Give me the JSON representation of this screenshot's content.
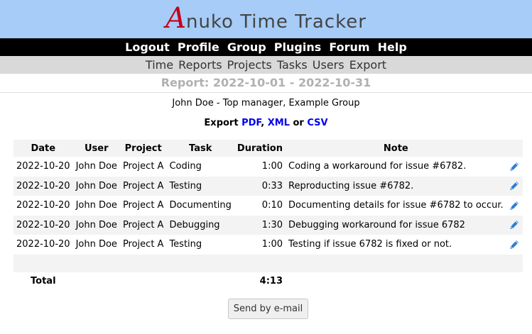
{
  "logo": {
    "first_letter": "A",
    "rest": "nuko Time Tracker"
  },
  "top_menu": [
    "Logout",
    "Profile",
    "Group",
    "Plugins",
    "Forum",
    "Help"
  ],
  "sub_menu": [
    "Time",
    "Reports",
    "Projects",
    "Tasks",
    "Users",
    "Export"
  ],
  "report": {
    "title": "Report: 2022-10-01 - 2022-10-31",
    "user_line": "John Doe - Top manager, Example Group",
    "export": {
      "prefix": "Export",
      "pdf": "PDF",
      "sep1": ",",
      "xml": "XML",
      "or": "or",
      "csv": "CSV"
    },
    "columns": [
      "Date",
      "User",
      "Project",
      "Task",
      "Duration",
      "Note"
    ],
    "rows": [
      {
        "date": "2022-10-20",
        "user": "John Doe",
        "project": "Project A",
        "task": "Coding",
        "duration": "1:00",
        "note": "Coding a workaround for issue #6782."
      },
      {
        "date": "2022-10-20",
        "user": "John Doe",
        "project": "Project A",
        "task": "Testing",
        "duration": "0:33",
        "note": "Reproducting issue #6782."
      },
      {
        "date": "2022-10-20",
        "user": "John Doe",
        "project": "Project A",
        "task": "Documenting",
        "duration": "0:10",
        "note": "Documenting details for issue #6782 to occur."
      },
      {
        "date": "2022-10-20",
        "user": "John Doe",
        "project": "Project A",
        "task": "Debugging",
        "duration": "1:30",
        "note": "Debugging workaround for issue 6782"
      },
      {
        "date": "2022-10-20",
        "user": "John Doe",
        "project": "Project A",
        "task": "Testing",
        "duration": "1:00",
        "note": "Testing if issue 6782 is fixed or not."
      }
    ],
    "total_label": "Total",
    "total_duration": "4:13",
    "send_button": "Send by e-mail"
  },
  "icons": {
    "edit": "pencil-icon"
  },
  "colors": {
    "header_bg": "#a6ccf7",
    "logo_red": "#c4001d",
    "link_blue": "#0000ee",
    "pencil_blue": "#2a7fd4"
  }
}
